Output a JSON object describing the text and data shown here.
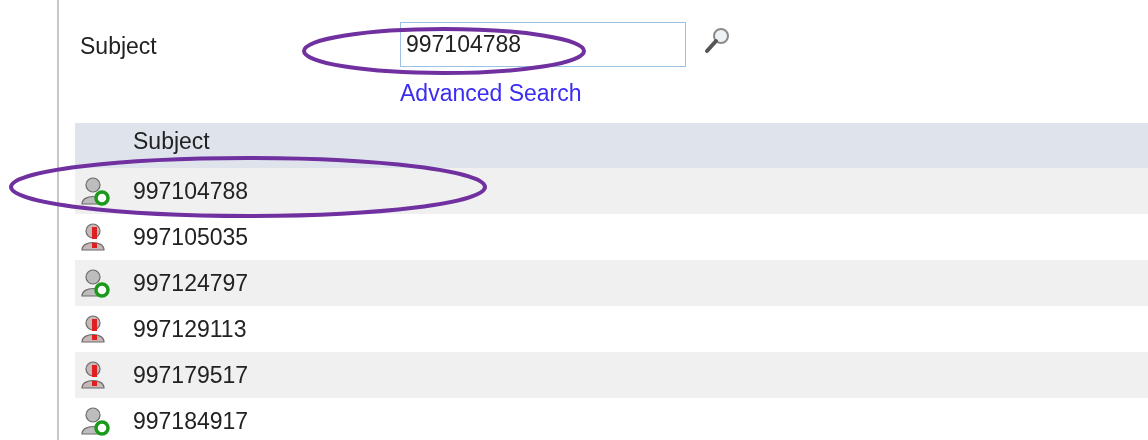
{
  "search": {
    "label": "Subject",
    "value": "997104788",
    "link": "Advanced Search"
  },
  "table": {
    "columns": [
      "Subject"
    ],
    "rows": [
      {
        "kind": "active",
        "subject": "997104788"
      },
      {
        "kind": "alert",
        "subject": "997105035"
      },
      {
        "kind": "active",
        "subject": "997124797"
      },
      {
        "kind": "alert",
        "subject": "997129113"
      },
      {
        "kind": "alert",
        "subject": "997179517"
      },
      {
        "kind": "active",
        "subject": "997184917"
      }
    ]
  }
}
